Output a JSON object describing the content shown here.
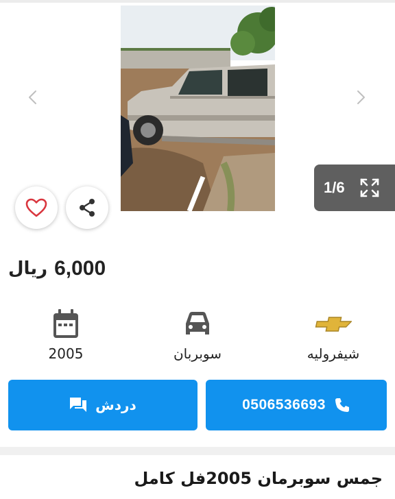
{
  "gallery": {
    "counter": "1/6",
    "icons": {
      "prev": "chevron-left-icon",
      "next": "chevron-right-icon",
      "fullscreen": "expand-icon",
      "favorite": "heart-icon",
      "share": "share-icon"
    }
  },
  "listing": {
    "price_value": "6,000",
    "price_currency": "ريال",
    "specs": {
      "make": "شيفروليه",
      "model": "سوبربان",
      "year": "2005"
    },
    "title": "جمس سوبرمان 2005فل كامل"
  },
  "actions": {
    "call_number": "0506536693",
    "chat_label": "دردش"
  },
  "colors": {
    "primary": "#1192ee",
    "counter_bg": "#5f5f5f",
    "heart": "#d9363e",
    "chevrolet": "#e0b43a"
  }
}
